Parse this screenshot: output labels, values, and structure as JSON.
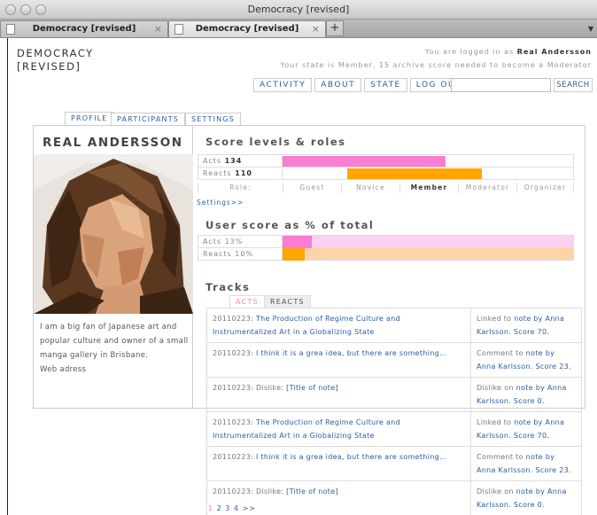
{
  "window": {
    "title": "Democracy [revised]"
  },
  "browser_tabs": [
    {
      "label": "Democracy [revised]",
      "close": "×",
      "active": false
    },
    {
      "label": "Democracy [revised]",
      "close": "×",
      "active": true
    }
  ],
  "new_tab_label": "+",
  "header": {
    "brand_line1": "DEMOCRACY",
    "brand_line2": "[REVISED]",
    "logged_in_prefix": "You are logged in as ",
    "user_name": "Real Andersson",
    "state_message": "Your state is Member, 15 archive score needed to become a Moderator"
  },
  "nav": {
    "items": [
      "ACTIVITY",
      "ABOUT",
      "STATE",
      "LOG OUT"
    ],
    "search_value": "",
    "search_label": "SEARCH"
  },
  "profile_tabs": [
    "PROFILE",
    "PARTICIPANTS",
    "SETTINGS"
  ],
  "profile": {
    "name": "REAL ANDERSSON",
    "bio": "I am a big fan of Japanese art and popular culture and owner of a small manga gallery in Brisbane.",
    "web_label": "Web adress"
  },
  "score_levels": {
    "title": "Score levels & roles",
    "rows": [
      {
        "label": "Acts",
        "value": "134",
        "color": "#f77ed2"
      },
      {
        "label": "Reacts",
        "value": "110",
        "color": "#ffa500"
      }
    ],
    "role_label": "Role:",
    "roles": [
      "Guest",
      "Novice",
      "Member",
      "Moderator",
      "Organizer"
    ],
    "current_role": "Member",
    "settings_link": "Settings>>"
  },
  "user_score": {
    "title": "User score as % of total",
    "rows": [
      {
        "label": "Acts 13%",
        "percent": 13,
        "fill": "#f77ed2",
        "track": "#fdd0f0"
      },
      {
        "label": "Reacts 10%",
        "percent": 10,
        "fill": "#ffa500",
        "track": "#fcd4a8"
      }
    ]
  },
  "tracks": {
    "title": "Tracks",
    "tabs": [
      "ACTS",
      "REACTS"
    ],
    "items": [
      {
        "date": "20110223: ",
        "text": "The Production of Regime Culture and Instrumentalized Art in a Globalizing State",
        "meta_prefix": "Linked to ",
        "meta_link": "note by Anna Karlsson. Score 70."
      },
      {
        "date": "20110223: ",
        "text": "I think it is a grea idea, but there are something...",
        "meta_prefix": "Comment to ",
        "meta_link": "note by Anna Karlsson. Score 23."
      },
      {
        "date": "20110223: Dislike: ",
        "text": "[Title of note]",
        "meta_prefix": "Dislike on ",
        "meta_link": "note by Anna Karlsson. Score 0."
      },
      {
        "date": "20110223: ",
        "text": "The Production of Regime Culture and Instrumentalized Art in a Globalizing State",
        "meta_prefix": "Linked to ",
        "meta_link": "note by Anna Karlsson. Score 70."
      },
      {
        "date": "20110223: ",
        "text": "I think it is a grea idea, but there are something...",
        "meta_prefix": "Comment to ",
        "meta_link": "note by Anna Karlsson. Score 23."
      },
      {
        "date": "20110223: Dislike: ",
        "text": "[Title of note]",
        "meta_prefix": "Dislike on ",
        "meta_link": "note by Anna Karlsson. Score 0."
      }
    ]
  },
  "pagination": {
    "pages": [
      "1",
      "2",
      "3",
      "4"
    ],
    "next": ">>"
  }
}
